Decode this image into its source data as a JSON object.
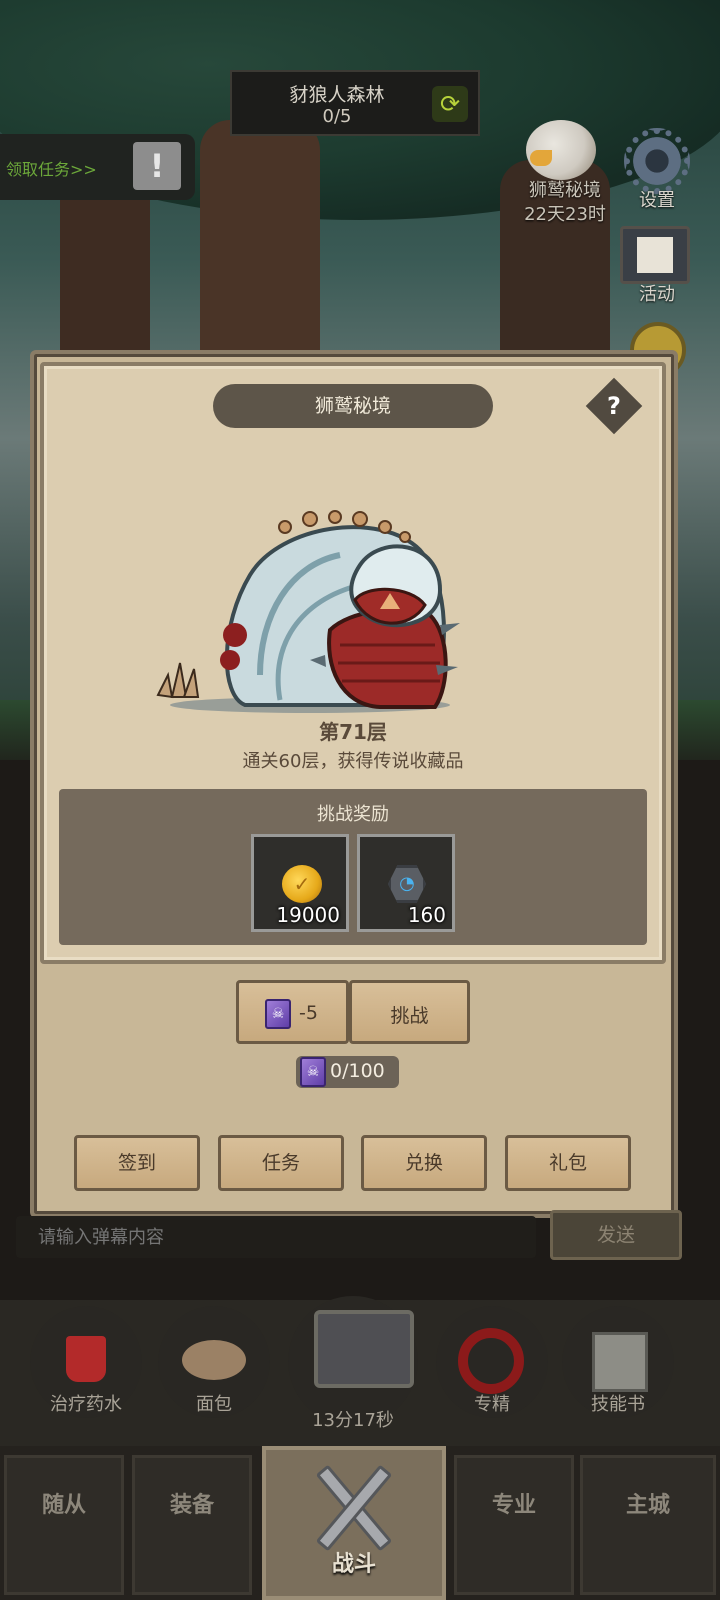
{
  "hud": {
    "stage_name": "豺狼人森林",
    "stage_progress": "0/5",
    "quest_link": "领取任务>>",
    "quest_alert": "!",
    "event_name": "狮鹫秘境",
    "event_time": "22天23时",
    "settings_label": "设置",
    "activity_label": "活动"
  },
  "panel": {
    "title": "狮鹫秘境",
    "help": "?",
    "floor": "第71层",
    "hint": "通关60层，获得传说收藏品",
    "rewards_title": "挑战奖励",
    "rewards": [
      {
        "icon": "gold-coin-icon",
        "amount": "19000"
      },
      {
        "icon": "gem-stone-icon",
        "amount": "160"
      }
    ],
    "cost": "-5",
    "challenge_label": "挑战",
    "ticket_count": "0/100",
    "buttons": [
      "签到",
      "任务",
      "兑换",
      "礼包"
    ]
  },
  "danmaku": {
    "placeholder": "请输入弹幕内容",
    "send_label": "发送"
  },
  "items": [
    {
      "label": "治疗药水",
      "icon": "potion-icon"
    },
    {
      "label": "面包",
      "icon": "bread-icon"
    },
    {
      "label": "13分17秒",
      "icon": "chest-icon"
    },
    {
      "label": "专精",
      "icon": "specialization-icon"
    },
    {
      "label": "技能书",
      "icon": "skill-book-icon"
    }
  ],
  "nav": {
    "tabs": [
      "随从",
      "装备",
      "战斗",
      "专业",
      "主城"
    ],
    "active": "战斗"
  }
}
